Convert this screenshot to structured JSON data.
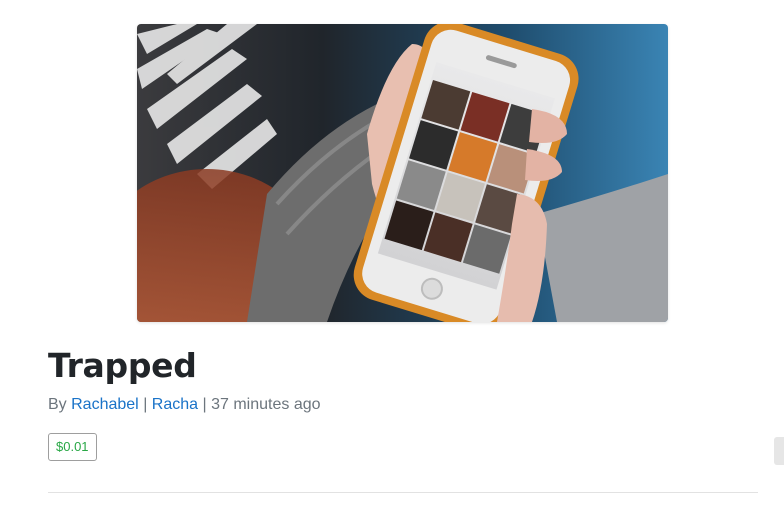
{
  "post": {
    "title": "Trapped",
    "byline": {
      "prefix": "By",
      "author": "Rachabel",
      "separator1": "|",
      "secondary_author": "Racha",
      "separator2": "|",
      "timestamp": "37 minutes ago"
    },
    "price": "$0.01"
  },
  "hero": {
    "icon": "hero-photo-icon",
    "alt": "Hands holding a smartphone showing a photo grid"
  },
  "colors": {
    "link": "#1a73c8",
    "price": "#28a745",
    "title": "#212529",
    "meta": "#6c757d"
  }
}
